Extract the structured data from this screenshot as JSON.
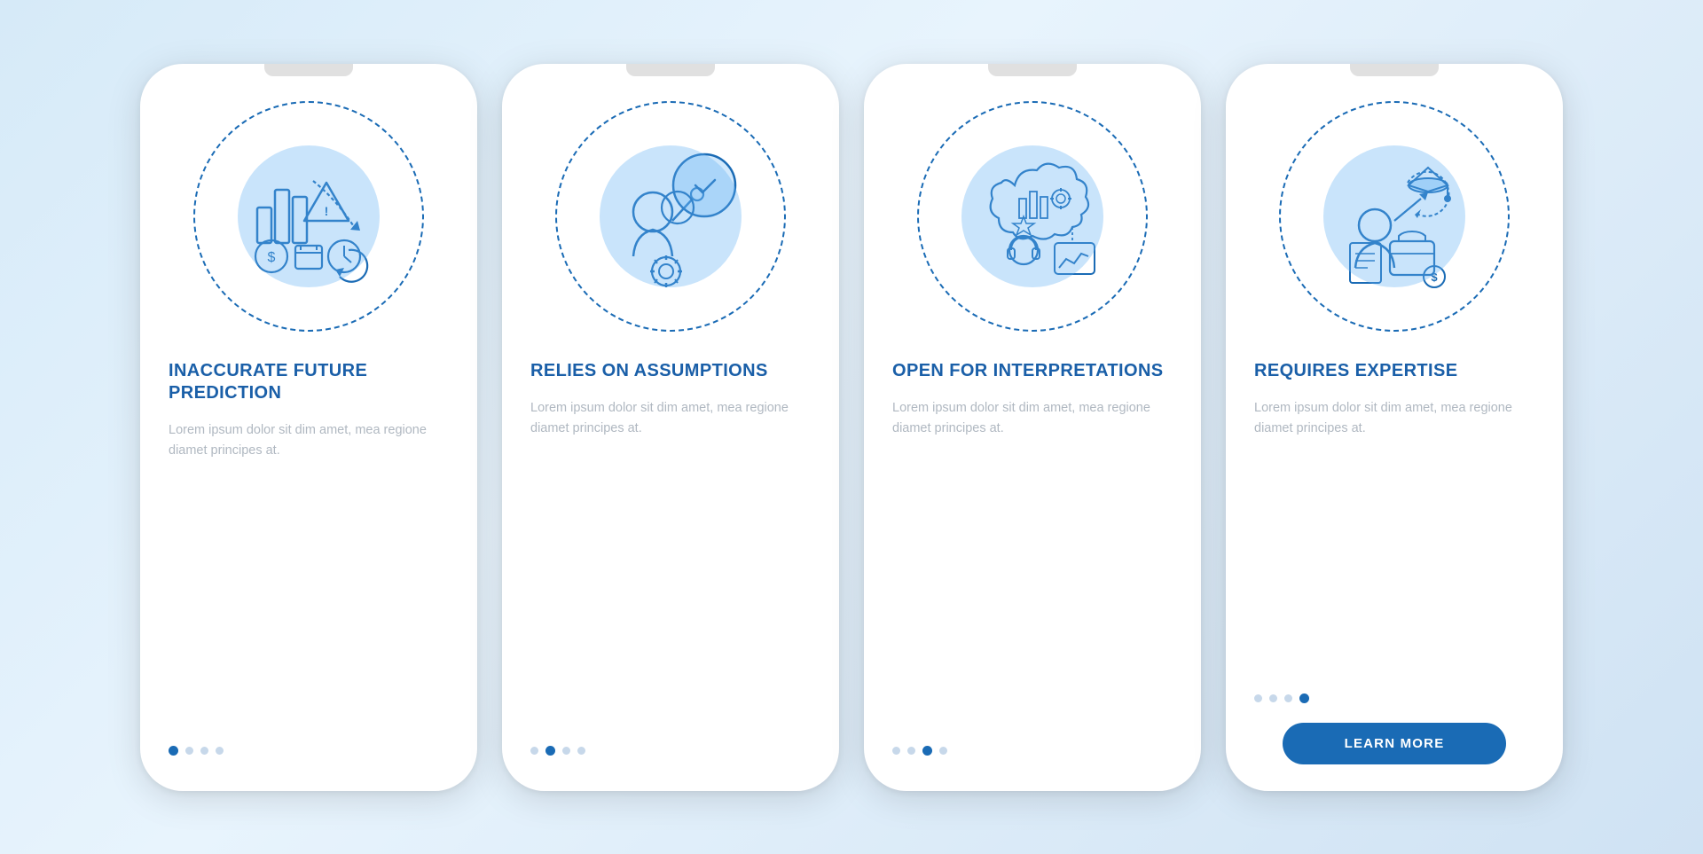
{
  "cards": [
    {
      "id": "card-1",
      "title": "INACCURATE FUTURE\nPREDICTION",
      "body": "Lorem ipsum dolor sit dim amet, mea regione diamet principes at.",
      "dots": [
        true,
        false,
        false,
        false
      ],
      "has_button": false,
      "button_label": ""
    },
    {
      "id": "card-2",
      "title": "RELIES ON\nASSUMPTIONS",
      "body": "Lorem ipsum dolor sit dim amet, mea regione diamet principes at.",
      "dots": [
        false,
        true,
        false,
        false
      ],
      "has_button": false,
      "button_label": ""
    },
    {
      "id": "card-3",
      "title": "OPEN FOR\nINTERPRETATIONS",
      "body": "Lorem ipsum dolor sit dim amet, mea regione diamet principes at.",
      "dots": [
        false,
        false,
        true,
        false
      ],
      "has_button": false,
      "button_label": ""
    },
    {
      "id": "card-4",
      "title": "REQUIRES EXPERTISE",
      "body": "Lorem ipsum dolor sit dim amet, mea regione diamet principes at.",
      "dots": [
        false,
        false,
        false,
        true
      ],
      "has_button": true,
      "button_label": "LEARN MORE"
    }
  ]
}
